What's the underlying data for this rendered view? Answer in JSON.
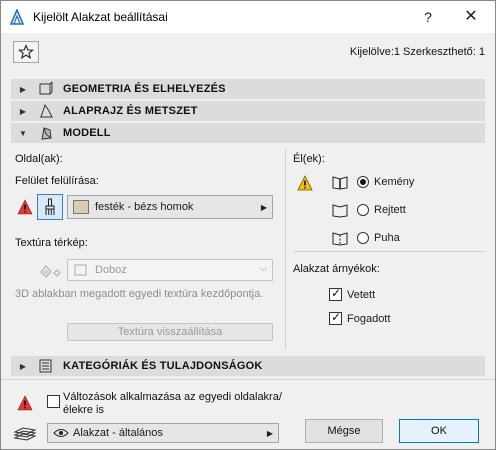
{
  "window": {
    "title": "Kijelölt Alakzat beállításai",
    "help_label": "?",
    "close_label": "✕"
  },
  "selection_info": "Kijelölve:1 Szerkeszthető: 1",
  "sections": {
    "geometry": "GEOMETRIA ÉS ELHELYEZÉS",
    "plan_section": "ALAPRAJZ ÉS METSZET",
    "model": "MODELL",
    "categories": "KATEGÓRIÁK ÉS TULAJDONSÁGOK"
  },
  "model": {
    "sides_label": "Oldal(ak):",
    "surface_override_label": "Felület felülírása:",
    "surface_value": "festék - bézs homok",
    "surface_swatch_color": "#d6ceb1",
    "texture_label": "Textúra térkép:",
    "texture_value": "Doboz",
    "texture_desc": "3D ablakban megadott egyedi textúra kezdőpontja.",
    "texture_reset": "Textúra visszaállítása",
    "edges_label": "Él(ek):",
    "edges": [
      {
        "label": "Kemény",
        "selected": true
      },
      {
        "label": "Rejtett",
        "selected": false
      },
      {
        "label": "Puha",
        "selected": false
      }
    ],
    "shadows_label": "Alakzat árnyékok:",
    "shadows": [
      {
        "label": "Vetett",
        "checked": true
      },
      {
        "label": "Fogadott",
        "checked": true
      }
    ]
  },
  "footer": {
    "apply_checkbox_label": "Változások alkalmazása az egyedi oldalakra/élekre is",
    "apply_checked": false,
    "favorites_value": "Alakzat - általános",
    "cancel_label": "Mégse",
    "ok_label": "OK"
  },
  "colors": {
    "warning": "#e53935",
    "accent": "#0078d7",
    "section_bg": "#dcdcdc"
  }
}
